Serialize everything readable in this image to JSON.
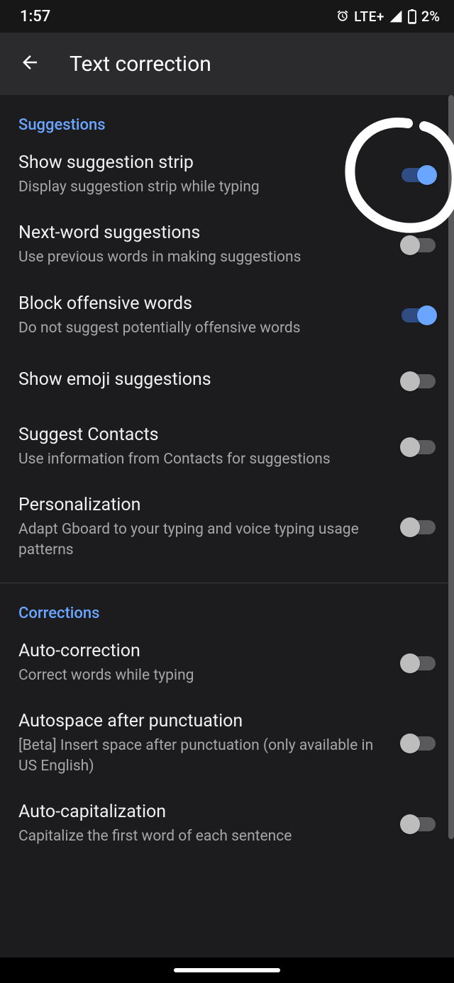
{
  "status": {
    "time": "1:57",
    "lte": "LTE+",
    "battery": "2%"
  },
  "appbar": {
    "title": "Text correction"
  },
  "sections": [
    {
      "key": "suggestions",
      "header": "Suggestions",
      "items": [
        {
          "key": "show-suggestion-strip",
          "title": "Show suggestion strip",
          "subtitle": "Display suggestion strip while typing",
          "on": true
        },
        {
          "key": "next-word-suggestions",
          "title": "Next-word suggestions",
          "subtitle": "Use previous words in making suggestions",
          "on": false
        },
        {
          "key": "block-offensive-words",
          "title": "Block offensive words",
          "subtitle": "Do not suggest potentially offensive words",
          "on": true
        },
        {
          "key": "show-emoji-suggestions",
          "title": "Show emoji suggestions",
          "subtitle": "",
          "on": false
        },
        {
          "key": "suggest-contacts",
          "title": "Suggest Contacts",
          "subtitle": "Use information from Contacts for suggestions",
          "on": false
        },
        {
          "key": "personalization",
          "title": "Personalization",
          "subtitle": "Adapt Gboard to your typing and voice typing usage patterns",
          "on": false
        }
      ]
    },
    {
      "key": "corrections",
      "header": "Corrections",
      "items": [
        {
          "key": "auto-correction",
          "title": "Auto-correction",
          "subtitle": "Correct words while typing",
          "on": false
        },
        {
          "key": "autospace-after-punctuation",
          "title": "Autospace after punctuation",
          "subtitle": "[Beta] Insert space after punctuation (only available in US English)",
          "on": false
        },
        {
          "key": "auto-capitalization",
          "title": "Auto-capitalization",
          "subtitle": "Capitalize the first word of each sentence",
          "on": false
        }
      ]
    }
  ]
}
